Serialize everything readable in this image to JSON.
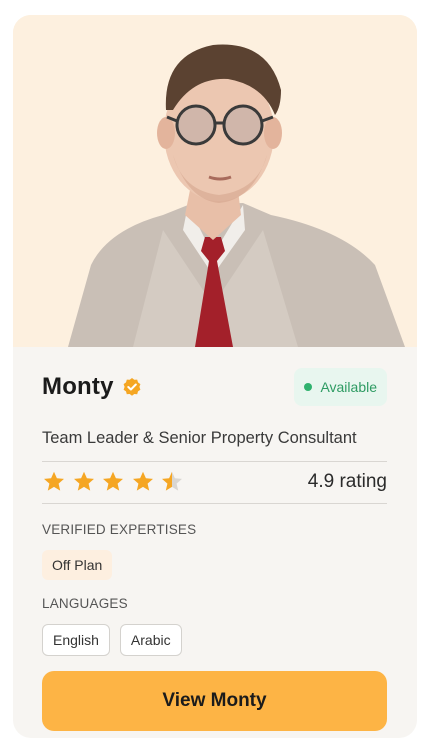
{
  "agent": {
    "name": "Monty",
    "verified_icon": "verified-badge-icon",
    "status": "Available",
    "role": "Team Leader & Senior Property Consultant",
    "rating_value": 4.5,
    "rating_max": 5,
    "rating_text": "4.9 rating"
  },
  "expertise": {
    "label": "VERIFIED EXPERTISES",
    "items": [
      "Off Plan"
    ]
  },
  "languages": {
    "label": "LANGUAGES",
    "items": [
      "English",
      "Arabic"
    ]
  },
  "cta": {
    "label": "View Monty"
  },
  "colors": {
    "accent": "#fdb445",
    "star": "#f5a623",
    "star_empty": "#d9d6d2",
    "available_green": "#2fb26e",
    "photo_bg": "#fdf0df"
  }
}
